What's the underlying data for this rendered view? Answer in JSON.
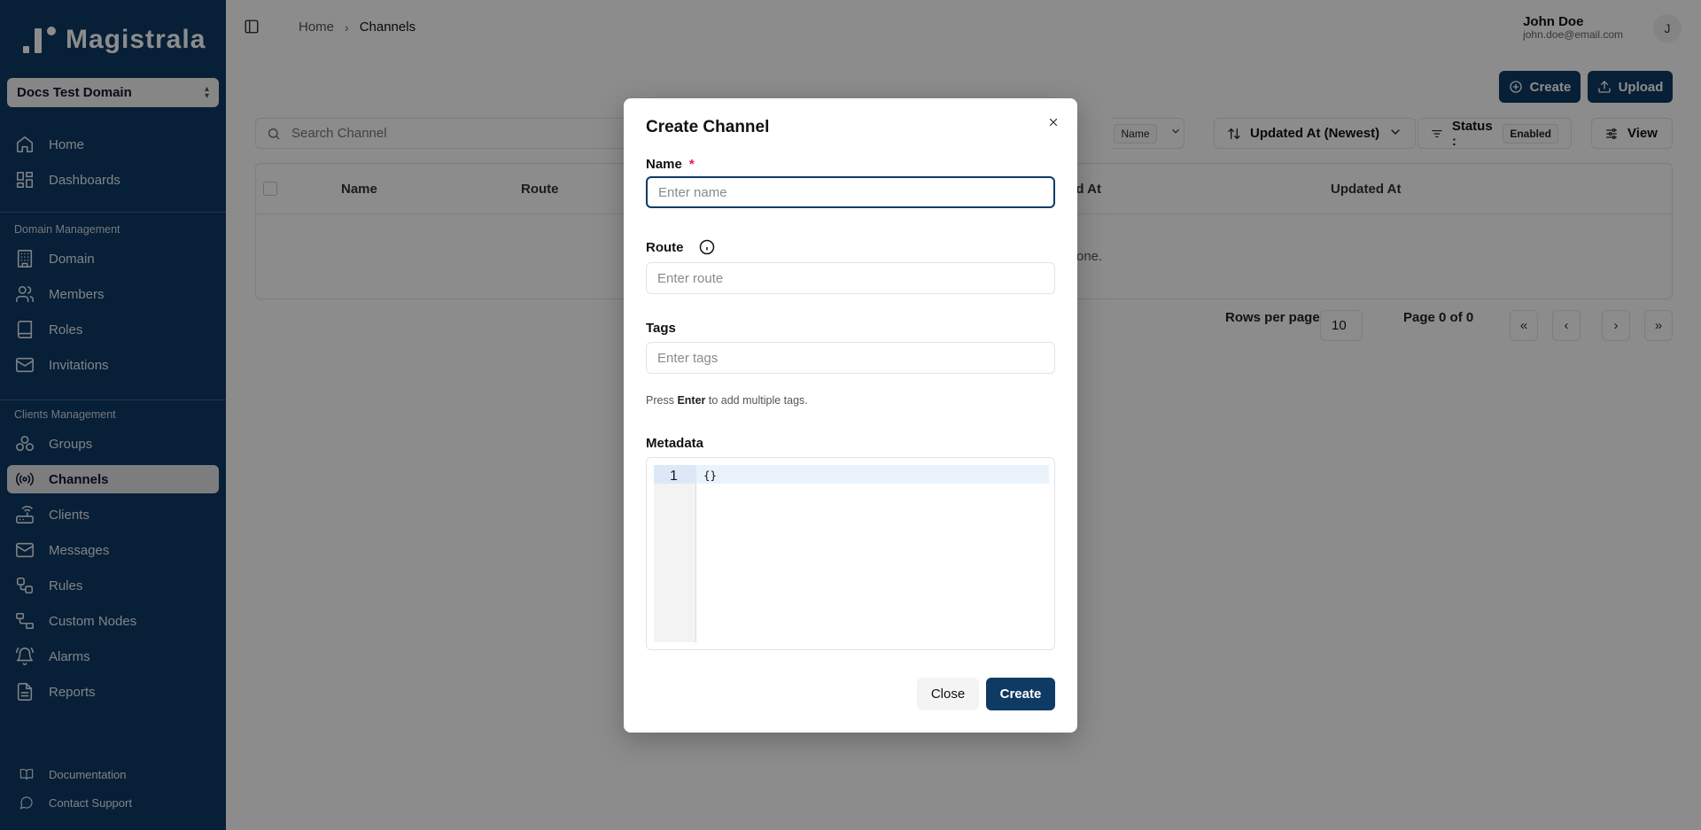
{
  "app": {
    "logo_text": "Magistrala"
  },
  "domain": {
    "name": "Docs Test Domain"
  },
  "sidebar": {
    "top_items": [
      {
        "label": "Home",
        "icon": "home-icon"
      },
      {
        "label": "Dashboards",
        "icon": "dashboard-icon"
      }
    ],
    "domain_section": {
      "label": "Domain Management",
      "items": [
        {
          "label": "Domain",
          "icon": "building-icon"
        },
        {
          "label": "Members",
          "icon": "users-icon"
        },
        {
          "label": "Roles",
          "icon": "book-icon"
        },
        {
          "label": "Invitations",
          "icon": "mail-icon"
        }
      ]
    },
    "clients_section": {
      "label": "Clients Management",
      "items": [
        {
          "label": "Groups",
          "icon": "groups-icon"
        },
        {
          "label": "Channels",
          "icon": "radio-icon",
          "active": true
        },
        {
          "label": "Clients",
          "icon": "router-icon"
        },
        {
          "label": "Messages",
          "icon": "mail-icon"
        },
        {
          "label": "Rules",
          "icon": "workflow-icon"
        },
        {
          "label": "Custom Nodes",
          "icon": "nodes-icon"
        },
        {
          "label": "Alarms",
          "icon": "bell-icon"
        },
        {
          "label": "Reports",
          "icon": "file-icon"
        }
      ]
    },
    "footer": [
      {
        "label": "Documentation",
        "icon": "book-open-icon"
      },
      {
        "label": "Contact Support",
        "icon": "chat-icon"
      }
    ]
  },
  "breadcrumb": {
    "home": "Home",
    "current": "Channels"
  },
  "user": {
    "name": "John Doe",
    "email": "john.doe@email.com",
    "initial": "J"
  },
  "toolbar": {
    "create_label": "Create",
    "upload_label": "Upload",
    "search_placeholder": "Search Channel",
    "search_field_pill": "Name",
    "sort_label": "Updated At (Newest)",
    "status_label": "Status :",
    "status_value": "Enabled",
    "view_label": "View"
  },
  "table": {
    "columns": [
      "Name",
      "Route",
      "Created At",
      "Updated At"
    ],
    "visible_columns": {
      "name": "Name",
      "route": "Route",
      "created_partial": "ed At",
      "updated": "Updated At"
    },
    "empty_partial": "one."
  },
  "pagination": {
    "rows_per_page_label": "Rows per page",
    "rows_per_page": "10",
    "page_text": "Page 0 of 0"
  },
  "dialog": {
    "title": "Create Channel",
    "name_label": "Name",
    "name_required": "*",
    "name_placeholder": "Enter name",
    "route_label": "Route",
    "route_placeholder": "Enter route",
    "tags_label": "Tags",
    "tags_placeholder": "Enter tags",
    "tags_hint_pre": "Press",
    "tags_hint_key": "Enter",
    "tags_hint_post": "to add multiple tags.",
    "metadata_label": "Metadata",
    "metadata_line_number": "1",
    "metadata_value": "{}",
    "close_label": "Close",
    "create_label": "Create"
  },
  "colors": {
    "brand": "#0e3a64",
    "required": "#e11d48"
  }
}
